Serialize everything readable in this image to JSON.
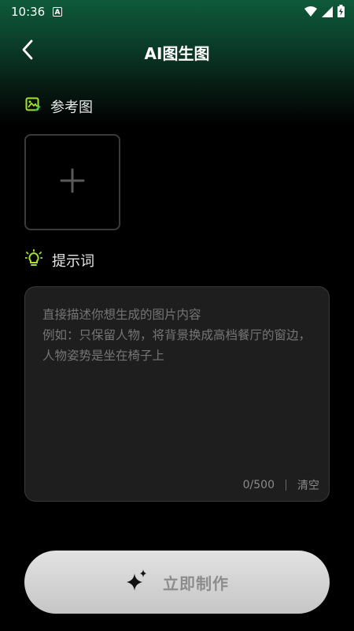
{
  "status_bar": {
    "time": "10:36",
    "indicator": "A",
    "icons": [
      "wifi-icon",
      "signal-icon",
      "battery-charging-icon"
    ]
  },
  "nav": {
    "title": "AI图生图",
    "back_icon": "chevron-left-icon"
  },
  "reference": {
    "label": "参考图",
    "icon": "image-edit-icon",
    "add_icon": "plus-icon"
  },
  "prompt": {
    "label": "提示词",
    "icon": "lightbulb-icon",
    "placeholder": "直接描述你想生成的图片内容\n例如：只保留人物，将背景换成高档餐厅的窗边，人物姿势是坐在椅子上",
    "value": "",
    "char_count": "0/500",
    "clear_label": "清空"
  },
  "action": {
    "make_label": "立即制作",
    "icon": "sparkle-icon"
  },
  "colors": {
    "accent_green": "#a6e22e",
    "header_gradient": "#0e5a3a"
  }
}
